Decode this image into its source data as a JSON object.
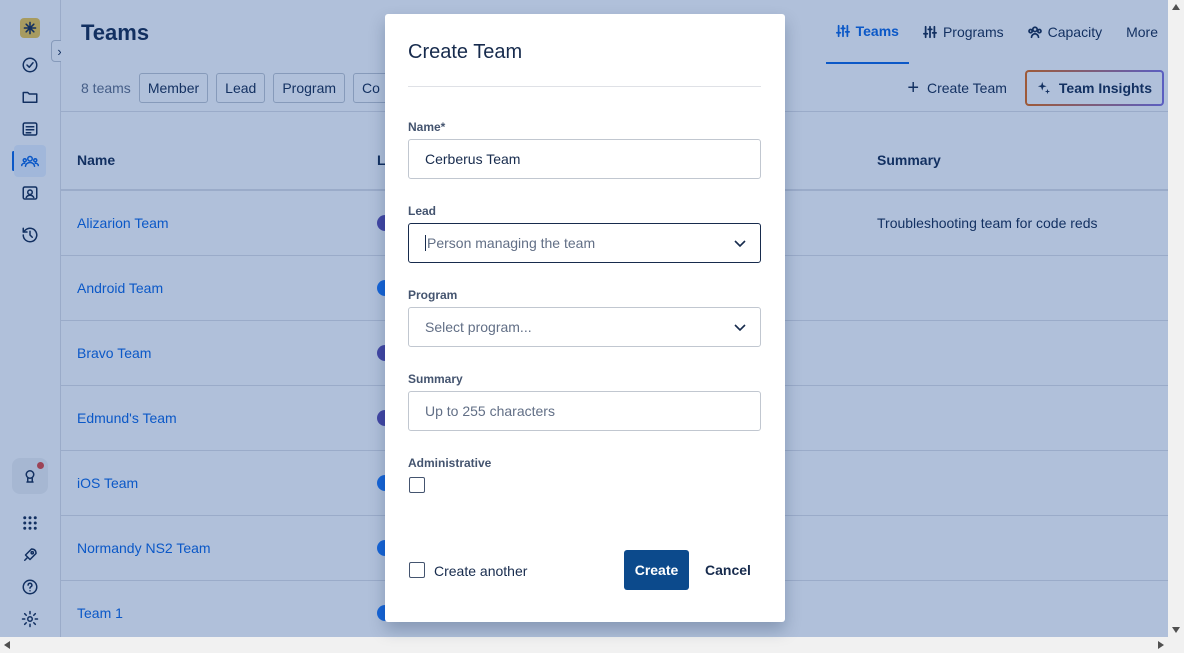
{
  "page": {
    "title": "Teams",
    "team_count": "8 teams"
  },
  "tabs": [
    {
      "label": "Teams",
      "icon": "sliders-icon"
    },
    {
      "label": "Programs",
      "icon": "sliders-icon"
    },
    {
      "label": "Capacity",
      "icon": "people-icon"
    },
    {
      "label": "More"
    }
  ],
  "filters": [
    "Member",
    "Lead",
    "Program",
    "Co"
  ],
  "actions": {
    "create_team": "Create Team",
    "team_insights": "Team Insights"
  },
  "table": {
    "headers": {
      "name": "Name",
      "lead": "L",
      "summary": "Summary"
    },
    "rows": [
      {
        "name": "Alizarion Team",
        "lead_color": "#5e4db2",
        "summary": "Troubleshooting team for code reds"
      },
      {
        "name": "Android Team",
        "lead_color": "#1d7afc",
        "summary": ""
      },
      {
        "name": "Bravo Team",
        "lead_color": "#5e4db2",
        "summary": ""
      },
      {
        "name": "Edmund's Team",
        "lead_color": "#5e4db2",
        "summary": ""
      },
      {
        "name": "iOS Team",
        "lead_color": "#1d7afc",
        "summary": ""
      },
      {
        "name": "Normandy NS2 Team",
        "lead_color": "#1d7afc",
        "summary": ""
      },
      {
        "name": "Team 1",
        "lead_color": "#1d7afc",
        "summary": ""
      }
    ]
  },
  "modal": {
    "title": "Create Team",
    "name_label": "Name*",
    "name_value": "Cerberus Team",
    "lead_label": "Lead",
    "lead_placeholder": "Person managing the team",
    "program_label": "Program",
    "program_placeholder": "Select program...",
    "summary_label": "Summary",
    "summary_placeholder": "Up to 255 characters",
    "admin_label": "Administrative",
    "create_another_label": "Create another",
    "create_button": "Create",
    "cancel_button": "Cancel"
  },
  "colors": {
    "accent": "#0c66e4",
    "primary_button": "#0c4a8c",
    "overlay": "rgba(9,60,140,0.32)"
  }
}
